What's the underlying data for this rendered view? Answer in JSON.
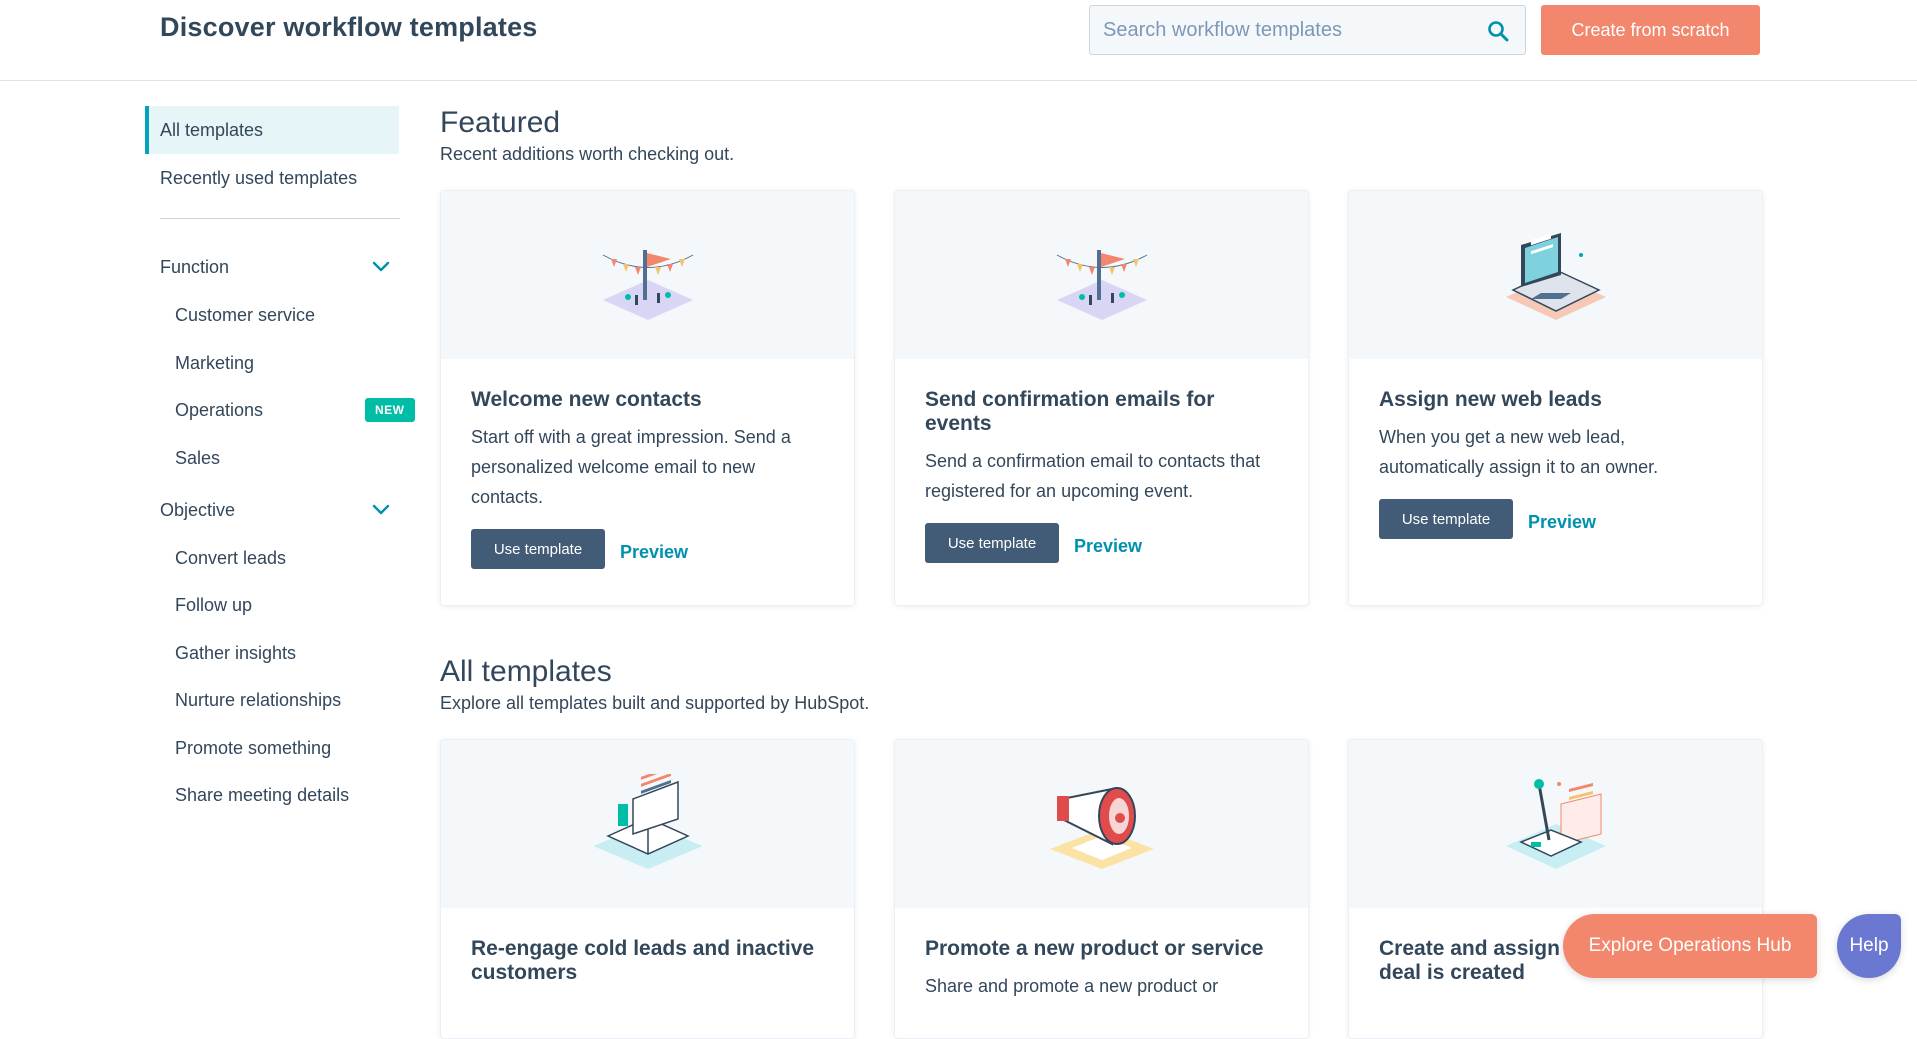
{
  "header": {
    "title": "Discover workflow templates",
    "search_placeholder": "Search workflow templates",
    "create_label": "Create from scratch"
  },
  "sidebar": {
    "nav": [
      {
        "label": "All templates",
        "active": true
      },
      {
        "label": "Recently used templates",
        "active": false
      }
    ],
    "groups": [
      {
        "label": "Function",
        "items": [
          {
            "label": "Customer service"
          },
          {
            "label": "Marketing"
          },
          {
            "label": "Operations",
            "badge": "NEW"
          },
          {
            "label": "Sales"
          }
        ]
      },
      {
        "label": "Objective",
        "items": [
          {
            "label": "Convert leads"
          },
          {
            "label": "Follow up"
          },
          {
            "label": "Gather insights"
          },
          {
            "label": "Nurture relationships"
          },
          {
            "label": "Promote something"
          },
          {
            "label": "Share meeting details"
          }
        ]
      }
    ]
  },
  "featured": {
    "title": "Featured",
    "subtitle": "Recent additions worth checking out.",
    "cards": [
      {
        "title": "Welcome new contacts",
        "description": "Start off with a great impression. Send a personalized welcome email to new contacts.",
        "use_label": "Use template",
        "preview_label": "Preview",
        "icon": "celebration-banner-icon"
      },
      {
        "title": "Send confirmation emails for events",
        "description": "Send a confirmation email to contacts that registered for an upcoming event.",
        "use_label": "Use template",
        "preview_label": "Preview",
        "icon": "celebration-banner-icon"
      },
      {
        "title": "Assign new web leads",
        "description": "When you get a new web lead, automatically assign it to an owner.",
        "use_label": "Use template",
        "preview_label": "Preview",
        "icon": "laptop-icon"
      }
    ]
  },
  "all_templates": {
    "title": "All templates",
    "subtitle": "Explore all templates built and supported by HubSpot.",
    "cards": [
      {
        "title": "Re-engage cold leads and inactive customers",
        "description": "",
        "icon": "open-book-icon"
      },
      {
        "title": "Promote a new product or service",
        "description": "Share and promote a new product or",
        "icon": "megaphone-icon"
      },
      {
        "title": "Create and assign ta",
        "title_line2": "deal is created",
        "description": "",
        "icon": "joystick-icon"
      }
    ]
  },
  "floating": {
    "explore_label": "Explore Operations Hub",
    "help_label": "Help"
  },
  "colors": {
    "accent_orange": "#f2876d",
    "dark_button": "#425b76",
    "link": "#0091ae",
    "active_bg": "#e5f5f8",
    "active_border": "#00a4bd",
    "badge": "#00bda5",
    "help": "#6a78d1"
  }
}
